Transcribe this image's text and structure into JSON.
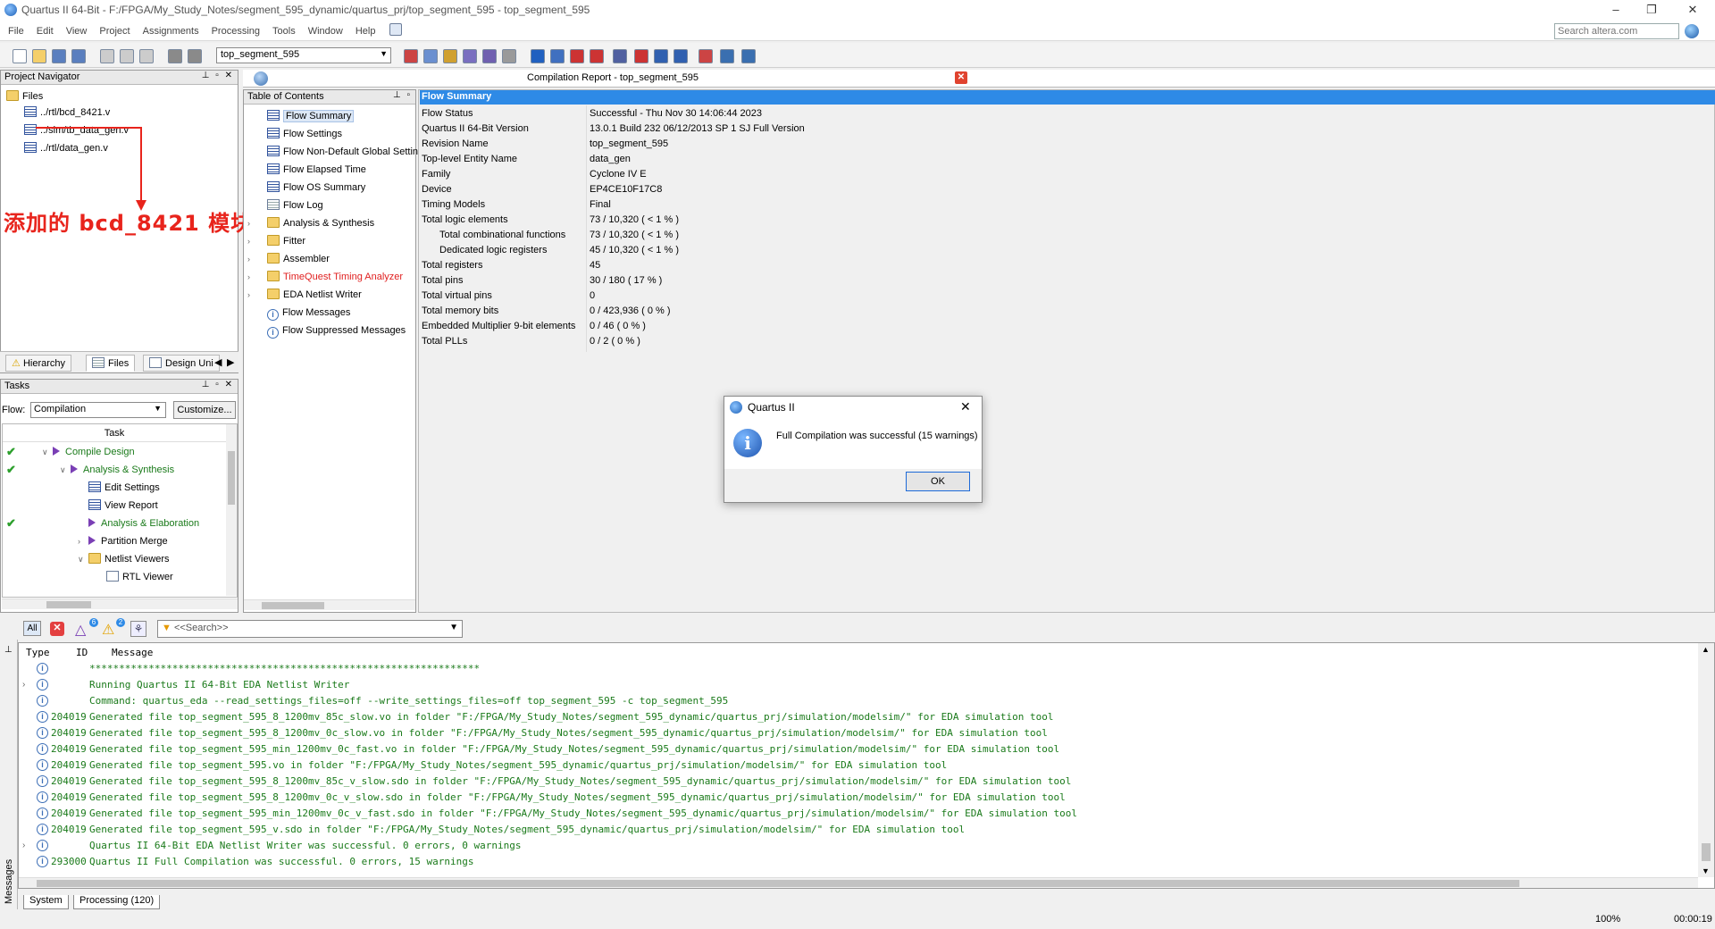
{
  "window": {
    "title": "Quartus II 64-Bit - F:/FPGA/My_Study_Notes/segment_595_dynamic/quartus_prj/top_segment_595 - top_segment_595",
    "controls": [
      "–",
      "❐",
      "✕"
    ]
  },
  "menu": [
    "File",
    "Edit",
    "View",
    "Project",
    "Assignments",
    "Processing",
    "Tools",
    "Window",
    "Help"
  ],
  "search": {
    "placeholder": "Search altera.com"
  },
  "toolbar": {
    "entity": "top_segment_595"
  },
  "project_navigator": {
    "title": "Project Navigator",
    "root": "Files",
    "files": [
      "../rtl/bcd_8421.v",
      "../sim/tb_data_gen.v",
      "../rtl/data_gen.v"
    ],
    "annotation": "添加的 bcd_8421 模块",
    "tabs": [
      "Hierarchy",
      "Files",
      "Design Uni"
    ]
  },
  "tasks": {
    "title": "Tasks",
    "flow_label": "Flow:",
    "flow_value": "Compilation",
    "customize": "Customize...",
    "column": "Task",
    "rows": [
      {
        "label": "Compile Design",
        "done": true,
        "indent": 0,
        "expander": "∨",
        "icon": "tri",
        "green": true
      },
      {
        "label": "Analysis & Synthesis",
        "done": true,
        "indent": 1,
        "expander": "∨",
        "icon": "tri",
        "green": true
      },
      {
        "label": "Edit Settings",
        "done": false,
        "indent": 2,
        "expander": "",
        "icon": "table",
        "green": false
      },
      {
        "label": "View Report",
        "done": false,
        "indent": 2,
        "expander": "",
        "icon": "table",
        "green": false
      },
      {
        "label": "Analysis & Elaboration",
        "done": true,
        "indent": 2,
        "expander": "",
        "icon": "tri",
        "green": true
      },
      {
        "label": "Partition Merge",
        "done": false,
        "indent": 2,
        "expander": "›",
        "icon": "tri",
        "green": false
      },
      {
        "label": "Netlist Viewers",
        "done": false,
        "indent": 2,
        "expander": "∨",
        "icon": "folder",
        "green": false
      },
      {
        "label": "RTL Viewer",
        "done": false,
        "indent": 3,
        "expander": "",
        "icon": "file",
        "green": false
      }
    ]
  },
  "toc": {
    "title": "Table of Contents",
    "items": [
      {
        "label": "Flow Summary",
        "icon": "table",
        "expander": false,
        "red": false,
        "selected": true
      },
      {
        "label": "Flow Settings",
        "icon": "table",
        "expander": false,
        "red": false,
        "selected": false
      },
      {
        "label": "Flow Non-Default Global Settin",
        "icon": "table",
        "expander": false,
        "red": false,
        "selected": false
      },
      {
        "label": "Flow Elapsed Time",
        "icon": "table",
        "expander": false,
        "red": false,
        "selected": false
      },
      {
        "label": "Flow OS Summary",
        "icon": "table",
        "expander": false,
        "red": false,
        "selected": false
      },
      {
        "label": "Flow Log",
        "icon": "doc",
        "expander": false,
        "red": false,
        "selected": false
      },
      {
        "label": "Analysis & Synthesis",
        "icon": "folder",
        "expander": true,
        "red": false,
        "selected": false
      },
      {
        "label": "Fitter",
        "icon": "folder",
        "expander": true,
        "red": false,
        "selected": false
      },
      {
        "label": "Assembler",
        "icon": "folder",
        "expander": true,
        "red": false,
        "selected": false
      },
      {
        "label": "TimeQuest Timing Analyzer",
        "icon": "folder",
        "expander": true,
        "red": true,
        "selected": false
      },
      {
        "label": "EDA Netlist Writer",
        "icon": "folder",
        "expander": true,
        "red": false,
        "selected": false
      },
      {
        "label": "Flow Messages",
        "icon": "info",
        "expander": false,
        "red": false,
        "selected": false
      },
      {
        "label": "Flow Suppressed Messages",
        "icon": "info",
        "expander": false,
        "red": false,
        "selected": false
      }
    ]
  },
  "report": {
    "title": "Compilation Report - top_segment_595",
    "section": "Flow Summary",
    "rows": [
      {
        "k": "Flow Status",
        "v": "Successful - Thu Nov 30 14:06:44 2023",
        "sub": false
      },
      {
        "k": "Quartus II 64-Bit Version",
        "v": "13.0.1 Build 232 06/12/2013 SP 1 SJ Full Version",
        "sub": false
      },
      {
        "k": "Revision Name",
        "v": "top_segment_595",
        "sub": false
      },
      {
        "k": "Top-level Entity Name",
        "v": "data_gen",
        "sub": false
      },
      {
        "k": "Family",
        "v": "Cyclone IV E",
        "sub": false
      },
      {
        "k": "Device",
        "v": "EP4CE10F17C8",
        "sub": false
      },
      {
        "k": "Timing Models",
        "v": "Final",
        "sub": false
      },
      {
        "k": "Total logic elements",
        "v": "73 / 10,320 ( < 1 % )",
        "sub": false
      },
      {
        "k": "Total combinational functions",
        "v": "73 / 10,320 ( < 1 % )",
        "sub": true
      },
      {
        "k": "Dedicated logic registers",
        "v": "45 / 10,320 ( < 1 % )",
        "sub": true
      },
      {
        "k": "Total registers",
        "v": "45",
        "sub": false
      },
      {
        "k": "Total pins",
        "v": "30 / 180 ( 17 % )",
        "sub": false
      },
      {
        "k": "Total virtual pins",
        "v": "0",
        "sub": false
      },
      {
        "k": "Total memory bits",
        "v": "0 / 423,936 ( 0 % )",
        "sub": false
      },
      {
        "k": "Embedded Multiplier 9-bit elements",
        "v": "0 / 46 ( 0 % )",
        "sub": false
      },
      {
        "k": "Total PLLs",
        "v": "0 / 2 ( 0 % )",
        "sub": false
      }
    ]
  },
  "dialog": {
    "title": "Quartus II",
    "message": "Full Compilation was successful (15 warnings)",
    "ok": "OK",
    "close": "✕"
  },
  "messages": {
    "filter_all": "All",
    "badge_1": "6",
    "badge_2": "2",
    "search_placeholder": "<<Search>>",
    "headers": [
      "Type",
      "ID",
      "Message"
    ],
    "lines": [
      {
        "id": "",
        "text": "******************************************************************",
        "exp": false
      },
      {
        "id": "",
        "text": "Running Quartus II 64-Bit EDA Netlist Writer",
        "exp": true
      },
      {
        "id": "",
        "text": "Command: quartus_eda --read_settings_files=off --write_settings_files=off top_segment_595 -c top_segment_595",
        "exp": false
      },
      {
        "id": "204019",
        "text": "Generated file top_segment_595_8_1200mv_85c_slow.vo in folder \"F:/FPGA/My_Study_Notes/segment_595_dynamic/quartus_prj/simulation/modelsim/\" for EDA simulation tool",
        "exp": false
      },
      {
        "id": "204019",
        "text": "Generated file top_segment_595_8_1200mv_0c_slow.vo in folder \"F:/FPGA/My_Study_Notes/segment_595_dynamic/quartus_prj/simulation/modelsim/\" for EDA simulation tool",
        "exp": false
      },
      {
        "id": "204019",
        "text": "Generated file top_segment_595_min_1200mv_0c_fast.vo in folder \"F:/FPGA/My_Study_Notes/segment_595_dynamic/quartus_prj/simulation/modelsim/\" for EDA simulation tool",
        "exp": false
      },
      {
        "id": "204019",
        "text": "Generated file top_segment_595.vo in folder \"F:/FPGA/My_Study_Notes/segment_595_dynamic/quartus_prj/simulation/modelsim/\" for EDA simulation tool",
        "exp": false
      },
      {
        "id": "204019",
        "text": "Generated file top_segment_595_8_1200mv_85c_v_slow.sdo in folder \"F:/FPGA/My_Study_Notes/segment_595_dynamic/quartus_prj/simulation/modelsim/\" for EDA simulation tool",
        "exp": false
      },
      {
        "id": "204019",
        "text": "Generated file top_segment_595_8_1200mv_0c_v_slow.sdo in folder \"F:/FPGA/My_Study_Notes/segment_595_dynamic/quartus_prj/simulation/modelsim/\" for EDA simulation tool",
        "exp": false
      },
      {
        "id": "204019",
        "text": "Generated file top_segment_595_min_1200mv_0c_v_fast.sdo in folder \"F:/FPGA/My_Study_Notes/segment_595_dynamic/quartus_prj/simulation/modelsim/\" for EDA simulation tool",
        "exp": false
      },
      {
        "id": "204019",
        "text": "Generated file top_segment_595_v.sdo in folder \"F:/FPGA/My_Study_Notes/segment_595_dynamic/quartus_prj/simulation/modelsim/\" for EDA simulation tool",
        "exp": false
      },
      {
        "id": "",
        "text": "Quartus II 64-Bit EDA Netlist Writer was successful. 0 errors, 0 warnings",
        "exp": true
      },
      {
        "id": "293000",
        "text": "Quartus II Full Compilation was successful. 0 errors, 15 warnings",
        "exp": false
      }
    ],
    "tabs": [
      "System",
      "Processing (120)"
    ],
    "side_label": "Messages"
  },
  "status": {
    "zoom": "100%",
    "time": "00:00:19"
  }
}
